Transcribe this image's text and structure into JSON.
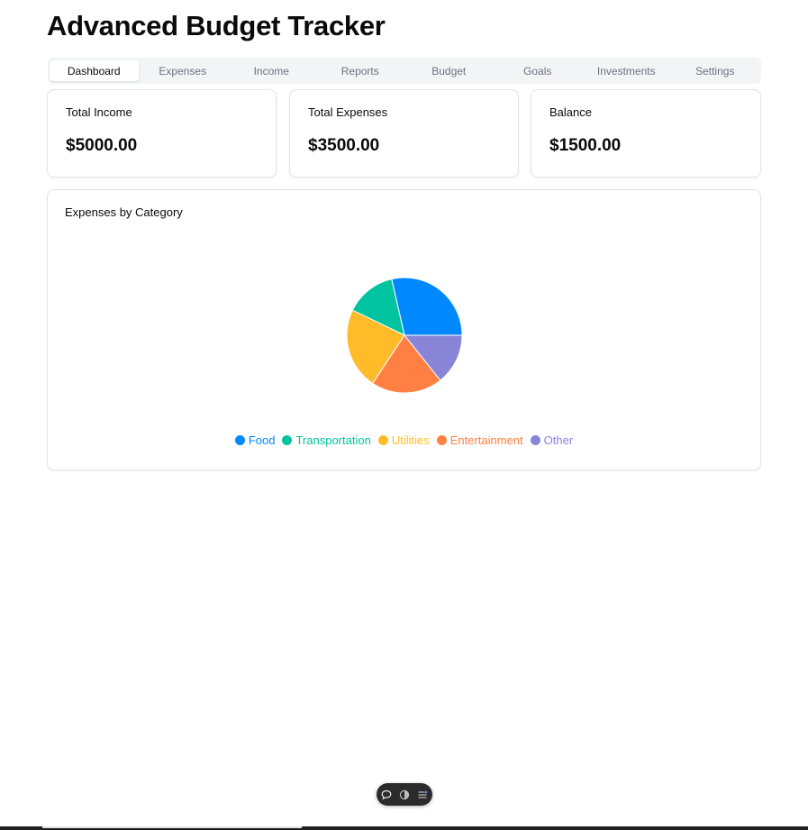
{
  "app": {
    "title": "Advanced Budget Tracker"
  },
  "tabs": [
    {
      "label": "Dashboard",
      "active": true
    },
    {
      "label": "Expenses",
      "active": false
    },
    {
      "label": "Income",
      "active": false
    },
    {
      "label": "Reports",
      "active": false
    },
    {
      "label": "Budget",
      "active": false
    },
    {
      "label": "Goals",
      "active": false
    },
    {
      "label": "Investments",
      "active": false
    },
    {
      "label": "Settings",
      "active": false
    }
  ],
  "summary": {
    "income": {
      "label": "Total Income",
      "value": "$5000.00"
    },
    "expenses": {
      "label": "Total Expenses",
      "value": "$3500.00"
    },
    "balance": {
      "label": "Balance",
      "value": "$1500.00"
    }
  },
  "chart_card": {
    "title": "Expenses by Category"
  },
  "chart_data": {
    "type": "pie",
    "title": "Expenses by Category",
    "categories": [
      "Food",
      "Transportation",
      "Utilities",
      "Entertainment",
      "Other"
    ],
    "values": [
      1000,
      500,
      800,
      700,
      500
    ],
    "colors": [
      "#0088fe",
      "#00c49f",
      "#ffbb28",
      "#ff8042",
      "#8884d8"
    ],
    "legend_position": "bottom"
  },
  "toolbar": {
    "icons": [
      "comment-icon",
      "contrast-toggle-icon",
      "menu-lines-icon"
    ]
  }
}
